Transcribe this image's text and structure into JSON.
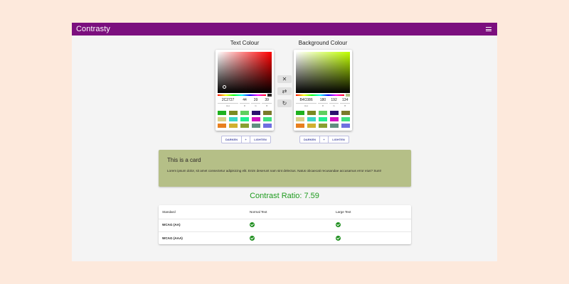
{
  "app": {
    "title": "Contrasty"
  },
  "text_picker": {
    "title": "Text Colour",
    "hue_color": "#ff0000",
    "current": "#2C2727",
    "fields": [
      {
        "value": "2C2727",
        "label": "Hex"
      },
      {
        "value": "44",
        "label": "R"
      },
      {
        "value": "39",
        "label": "G"
      },
      {
        "value": "39",
        "label": "B"
      }
    ],
    "swatches": [
      "#1fb11f",
      "#7a8a22",
      "#5fcf5f",
      "#2c1070",
      "#7a7a2a",
      "#d8d089",
      "#38d6c8",
      "#1ff08f",
      "#d010c0",
      "#3fe07f",
      "#e8801f",
      "#d0b030",
      "#88a030",
      "#5f8f7f",
      "#6f6fe0"
    ],
    "buttons": {
      "darken": "DARKEN",
      "sep": "+",
      "lighten": "LIGHTEN"
    }
  },
  "bg_picker": {
    "title": "Background Colour",
    "hue_color": "#c0ff00",
    "current": "#B4C086",
    "fields": [
      {
        "value": "B4C086",
        "label": "Hex"
      },
      {
        "value": "180",
        "label": "R"
      },
      {
        "value": "192",
        "label": "G"
      },
      {
        "value": "134",
        "label": "B"
      }
    ],
    "swatches": [
      "#1fb11f",
      "#7a8a22",
      "#5fcf5f",
      "#2c1070",
      "#7a7a2a",
      "#d8d089",
      "#38d6c8",
      "#1ff08f",
      "#d010c0",
      "#3fe07f",
      "#e8801f",
      "#d0b030",
      "#88a030",
      "#5f8f7f",
      "#6f6fe0"
    ],
    "buttons": {
      "darken": "DARKEN",
      "sep": "+",
      "lighten": "LIGHTEN"
    }
  },
  "actions": [
    {
      "icon": "close-icon",
      "glyph": "✕"
    },
    {
      "icon": "swap-icon",
      "glyph": "⇄"
    },
    {
      "icon": "refresh-icon",
      "glyph": "↻"
    }
  ],
  "card": {
    "title": "This is a card",
    "body": "Lorem ipsum dolor, sit amet consectetur adipisicing elit. Enim deserunt nam sint delectus. Natus obcaecati recusandae accusamus error eius? Sunt!"
  },
  "contrast": {
    "text": "Contrast Ratio: 7.59"
  },
  "table": {
    "headers": [
      "Standard",
      "Normal Text",
      "Large Text"
    ],
    "rows": [
      {
        "standard": "WCAG (AA)",
        "normal": "pass",
        "large": "pass"
      },
      {
        "standard": "WCAG (AAA)",
        "normal": "pass",
        "large": "pass"
      }
    ]
  },
  "colors": {
    "brand": "#7b0f7e",
    "pass": "#1e8e1e",
    "ratio": "#1f9b1f"
  }
}
